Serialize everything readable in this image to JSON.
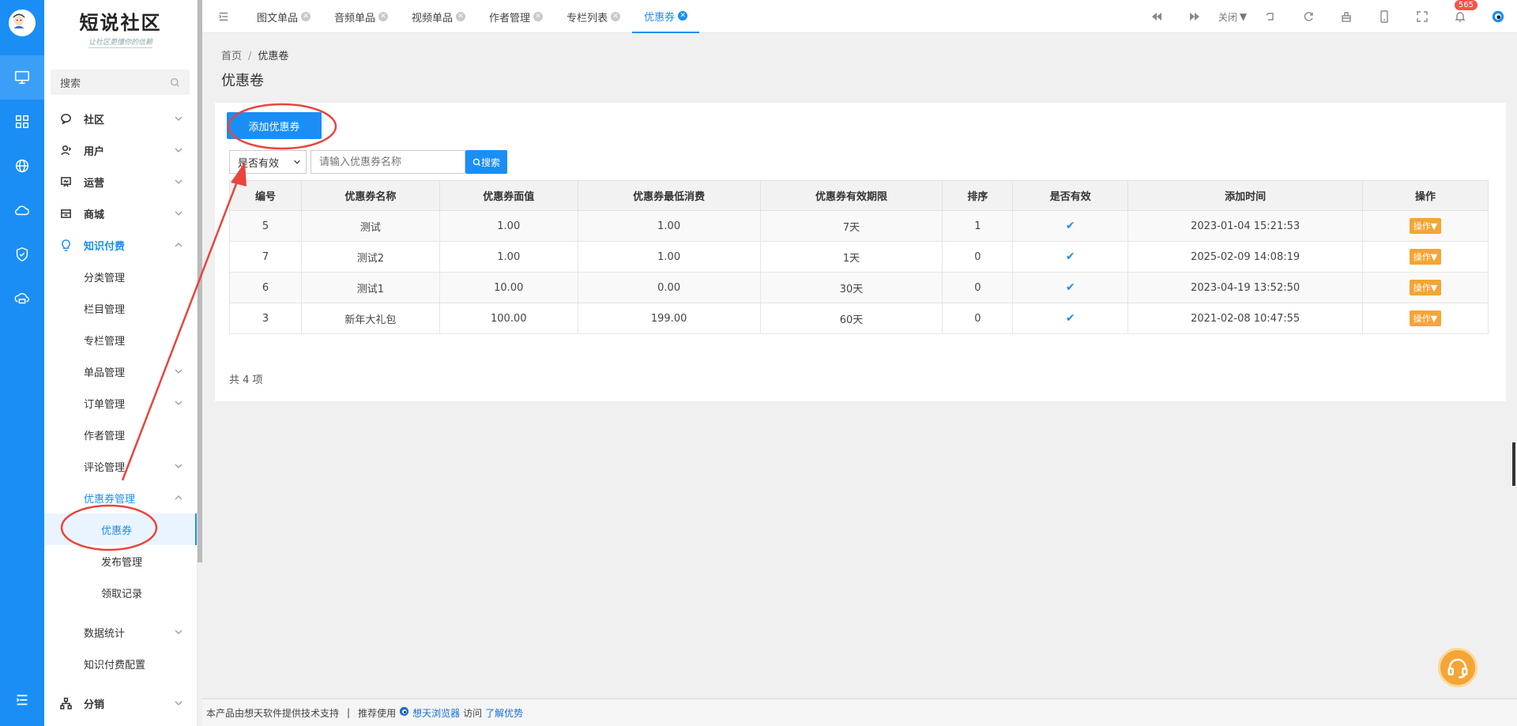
{
  "brand": {
    "title": "短说社区",
    "slogan": "让社区更懂你的信赖"
  },
  "search": {
    "placeholder": "搜索"
  },
  "nav": {
    "community": "社区",
    "user": "用户",
    "operation": "运营",
    "mall": "商城",
    "knowledge": "知识付费",
    "k_items": {
      "category": "分类管理",
      "column": "栏目管理",
      "special": "专栏管理",
      "single": "单品管理",
      "order": "订单管理",
      "author": "作者管理",
      "comment": "评论管理",
      "coupon_mgmt": "优惠券管理"
    },
    "coupon_items": {
      "coupon": "优惠券",
      "publish": "发布管理",
      "receive": "领取记录"
    },
    "stats": "数据统计",
    "kconfig": "知识付费配置",
    "distribution": "分销"
  },
  "tabs": [
    {
      "label": "图文单品"
    },
    {
      "label": "音频单品"
    },
    {
      "label": "视频单品"
    },
    {
      "label": "作者管理"
    },
    {
      "label": "专栏列表"
    },
    {
      "label": "优惠券"
    }
  ],
  "toolbar": {
    "close_label": "关闭",
    "notify_count": "565"
  },
  "breadcrumb": {
    "home": "首页",
    "current": "优惠卷"
  },
  "page_title": "优惠卷",
  "add_button": "添加优惠券",
  "filter": {
    "select_value": "是否有效",
    "keyword_placeholder": "请输入优惠券名称",
    "search_label": "搜索"
  },
  "table": {
    "headers": {
      "id": "编号",
      "name": "优惠券名称",
      "value": "优惠券面值",
      "min": "优惠券最低消费",
      "period": "优惠券有效期限",
      "sort": "排序",
      "valid": "是否有效",
      "time": "添加时间",
      "op": "操作"
    },
    "rows": [
      {
        "id": "5",
        "name": "测试",
        "value": "1.00",
        "min": "1.00",
        "period": "7天",
        "sort": "1",
        "time": "2023-01-04 15:21:53",
        "op": "操作"
      },
      {
        "id": "7",
        "name": "测试2",
        "value": "1.00",
        "min": "1.00",
        "period": "1天",
        "sort": "0",
        "time": "2025-02-09 14:08:19",
        "op": "操作"
      },
      {
        "id": "6",
        "name": "测试1",
        "value": "10.00",
        "min": "0.00",
        "period": "30天",
        "sort": "0",
        "time": "2023-04-19 13:52:50",
        "op": "操作"
      },
      {
        "id": "3",
        "name": "新年大礼包",
        "value": "100.00",
        "min": "199.00",
        "period": "60天",
        "sort": "0",
        "time": "2021-02-08 10:47:55",
        "op": "操作"
      }
    ]
  },
  "total": "共 4 项",
  "footer": {
    "text1": "本产品由想天软件提供技术支持",
    "text2": "推荐使用",
    "browser": "想天浏览器",
    "text3": "访问",
    "learn": "了解优势"
  },
  "colors": {
    "accent": "#1a8ef5",
    "warning": "#f5a533",
    "annotation": "#e8453c"
  }
}
